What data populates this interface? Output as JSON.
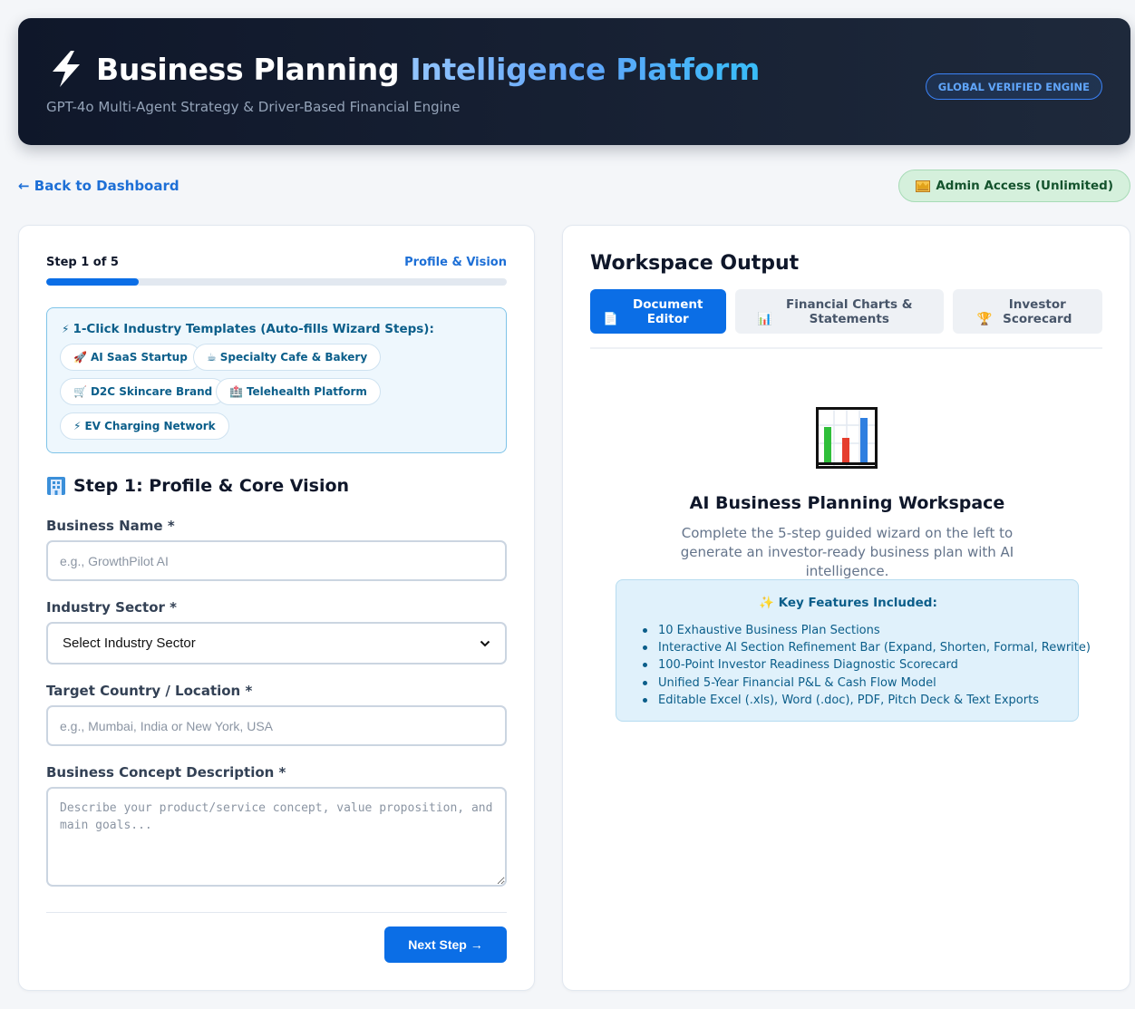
{
  "header": {
    "title_part1": "Business Planning",
    "title_part2": "Intelligence Platform",
    "subtitle": "GPT-4o Multi-Agent Strategy & Driver-Based Financial Engine",
    "badge": "GLOBAL VERIFIED ENGINE"
  },
  "nav": {
    "back_label": "← Back to Dashboard",
    "admin_label": "Admin Access (Unlimited)"
  },
  "wizard": {
    "step_count": "Step 1 of 5",
    "step_name": "Profile & Vision",
    "progress_fraction": 0.2,
    "templates": {
      "heading": "1-Click Industry Templates (Auto-fills Wizard Steps):",
      "items": [
        {
          "emoji": "🚀",
          "label": "AI SaaS Startup"
        },
        {
          "emoji": "☕",
          "label": "Specialty Cafe & Bakery"
        },
        {
          "emoji": "🛒",
          "label": "D2C Skincare Brand"
        },
        {
          "emoji": "🏥",
          "label": "Telehealth Platform"
        },
        {
          "emoji": "⚡",
          "label": "EV Charging Network"
        }
      ]
    },
    "section_title": "Step 1: Profile & Core Vision",
    "fields": {
      "business_name": {
        "label": "Business Name *",
        "placeholder": "e.g., GrowthPilot AI"
      },
      "industry": {
        "label": "Industry Sector *",
        "value": "Select Industry Sector"
      },
      "location": {
        "label": "Target Country / Location *",
        "placeholder": "e.g., Mumbai, India or New York, USA"
      },
      "description": {
        "label": "Business Concept Description *",
        "placeholder": "Describe your product/service concept, value proposition, and main goals..."
      }
    },
    "next_label": "Next Step →"
  },
  "workspace": {
    "title": "Workspace Output",
    "tabs": [
      {
        "icon": "📄",
        "label": "Document Editor",
        "active": true
      },
      {
        "icon": "📊",
        "label": "Financial Charts & Statements",
        "active": false
      },
      {
        "icon": "🏆",
        "label": "Investor Scorecard",
        "active": false
      }
    ],
    "empty_title": "AI Business Planning Workspace",
    "empty_desc": "Complete the 5-step guided wizard on the left to generate an investor-ready business plan with AI intelligence.",
    "features_heading": "✨ Key Features Included:",
    "features": [
      "10 Exhaustive Business Plan Sections",
      "Interactive AI Section Refinement Bar (Expand, Shorten, Formal, Rewrite)",
      "100-Point Investor Readiness Diagnostic Scorecard",
      "Unified 5-Year Financial P&L & Cash Flow Model",
      "Editable Excel (.xls), Word (.doc), PDF, Pitch Deck & Text Exports"
    ]
  },
  "colors": {
    "accent": "#0b6ee6",
    "hero_bg": "#0f172a",
    "admin_bg": "#d5f0dc",
    "info_box": "#e0f1fb"
  }
}
